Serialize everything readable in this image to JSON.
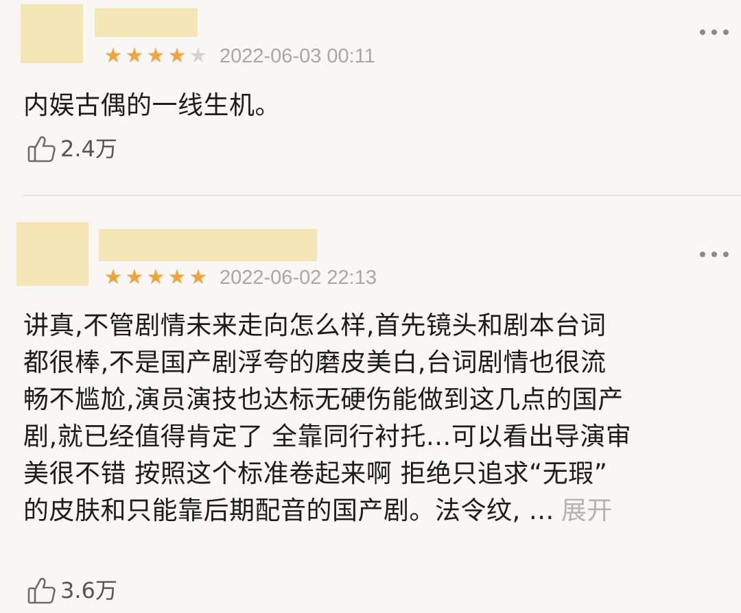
{
  "reviews": [
    {
      "rating": 4,
      "max_rating": 5,
      "date": "2022-06-03 00:11",
      "content_lines": [
        "内娱古偶的一线生机。"
      ],
      "likes": "2.4万",
      "icons": {
        "more": "more-dots-icon",
        "like": "thumbs-up-icon"
      }
    },
    {
      "rating": 5,
      "max_rating": 5,
      "date": "2022-06-02 22:13",
      "content_lines": [
        "讲真,不管剧情未来走向怎么样,首先镜头和剧本台词",
        "都很棒,不是国产剧浮夸的磨皮美白,台词剧情也很流",
        "畅不尴尬,演员演技也达标无硬伤能做到这几点的国产",
        "剧,就已经值得肯定了 全靠同行衬托...可以看出导演审",
        "美很不错 按照这个标准卷起来啊 拒绝只追求“无瑕”",
        "的皮肤和只能靠后期配音的国产剧。法令纹, ..."
      ],
      "expand_label": "展开",
      "likes": "3.6万",
      "icons": {
        "more": "more-dots-icon",
        "like": "thumbs-up-icon"
      }
    }
  ],
  "colors": {
    "background": "#f8f7f5",
    "star_on": "#f2a33a",
    "star_off": "#d3d3d3",
    "redaction": "#f3e6b4",
    "muted_text": "#a7a7a7"
  }
}
